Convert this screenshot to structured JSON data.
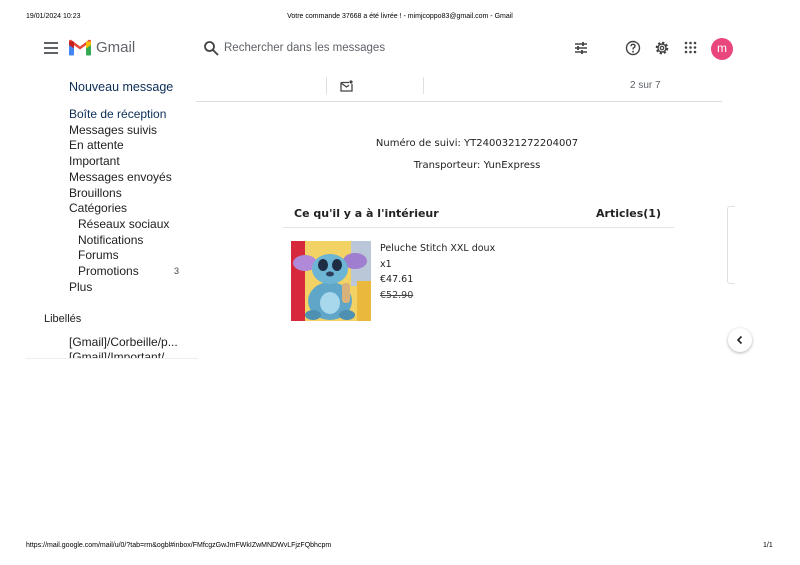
{
  "print_header": {
    "datetime": "19/01/2024 10:23",
    "title": "Votre commande 37668 a été livrée ! - mimjcoppo83@gmail.com - Gmail"
  },
  "topbar": {
    "app_name": "Gmail",
    "search_placeholder": "Rechercher dans les messages",
    "avatar_letter": "m",
    "avatar_color": "#e8467c"
  },
  "sidebar": {
    "compose_label": "Nouveau message",
    "items": [
      {
        "label": "Boîte de réception"
      },
      {
        "label": "Messages suivis"
      },
      {
        "label": "En attente"
      },
      {
        "label": "Important"
      },
      {
        "label": "Messages envoyés"
      },
      {
        "label": "Brouillons"
      },
      {
        "label": "Catégories"
      },
      {
        "label": "Réseaux sociaux"
      },
      {
        "label": "Notifications"
      },
      {
        "label": "Forums"
      },
      {
        "label": "Promotions",
        "count": "3"
      },
      {
        "label": "Plus"
      }
    ],
    "labels_title": "Libellés",
    "labels": [
      {
        "label": "[Gmail]/Corbeille/p..."
      },
      {
        "label": "[Gmail]/Important/..."
      }
    ]
  },
  "toolbar": {
    "pager": "2 sur 7"
  },
  "email": {
    "tracking": "Numéro de suivi: YT2400321272204007",
    "carrier": "Transporteur: YunExpress",
    "inside_title": "Ce qu'il y a à l'intérieur",
    "articles_label": "Articles(1)",
    "product": {
      "name": "Peluche Stitch XXL doux",
      "quantity": "x1",
      "price": "€47.61",
      "old_price": "€52.90"
    }
  },
  "print_footer": {
    "url": "https://mail.google.com/mail/u/0/?tab=rm&ogbl#inbox/FMfcgzGwJmFWkIZwMNDWvLFjzFQbhcpm",
    "page": "1/1"
  }
}
